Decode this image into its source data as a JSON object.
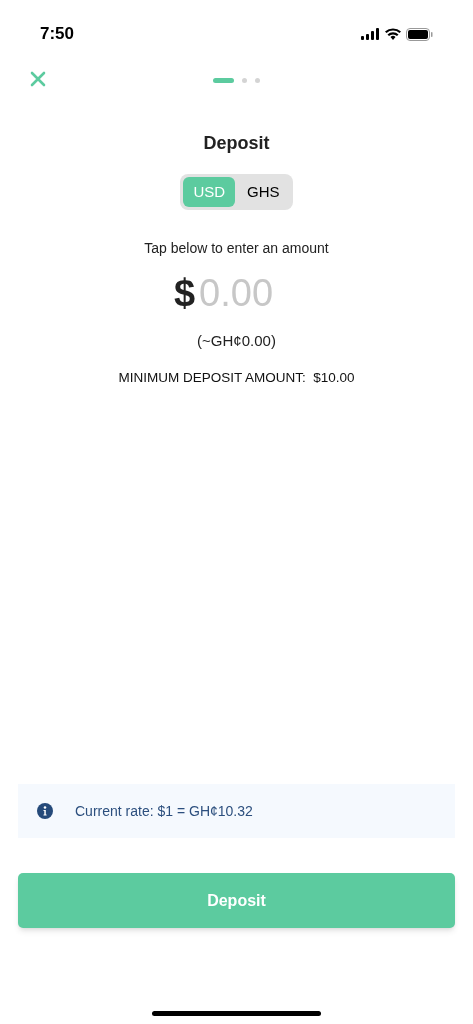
{
  "status_bar": {
    "time": "7:50"
  },
  "steps": [
    {
      "selected": true
    },
    {
      "selected": false
    },
    {
      "selected": false
    }
  ],
  "title": "Deposit",
  "currencies": [
    {
      "label": "USD",
      "selected": true
    },
    {
      "label": "GHS",
      "selected": false
    }
  ],
  "prompt": "Tap below to enter an amount",
  "amount": {
    "symbol": "$",
    "placeholder": "0.00"
  },
  "converted": "(~GH¢0.00)",
  "minimum": "MINIMUM DEPOSIT AMOUNT:  $10.00",
  "rate_note": "Current rate: $1 = GH¢10.32",
  "deposit_button": "Deposit"
}
